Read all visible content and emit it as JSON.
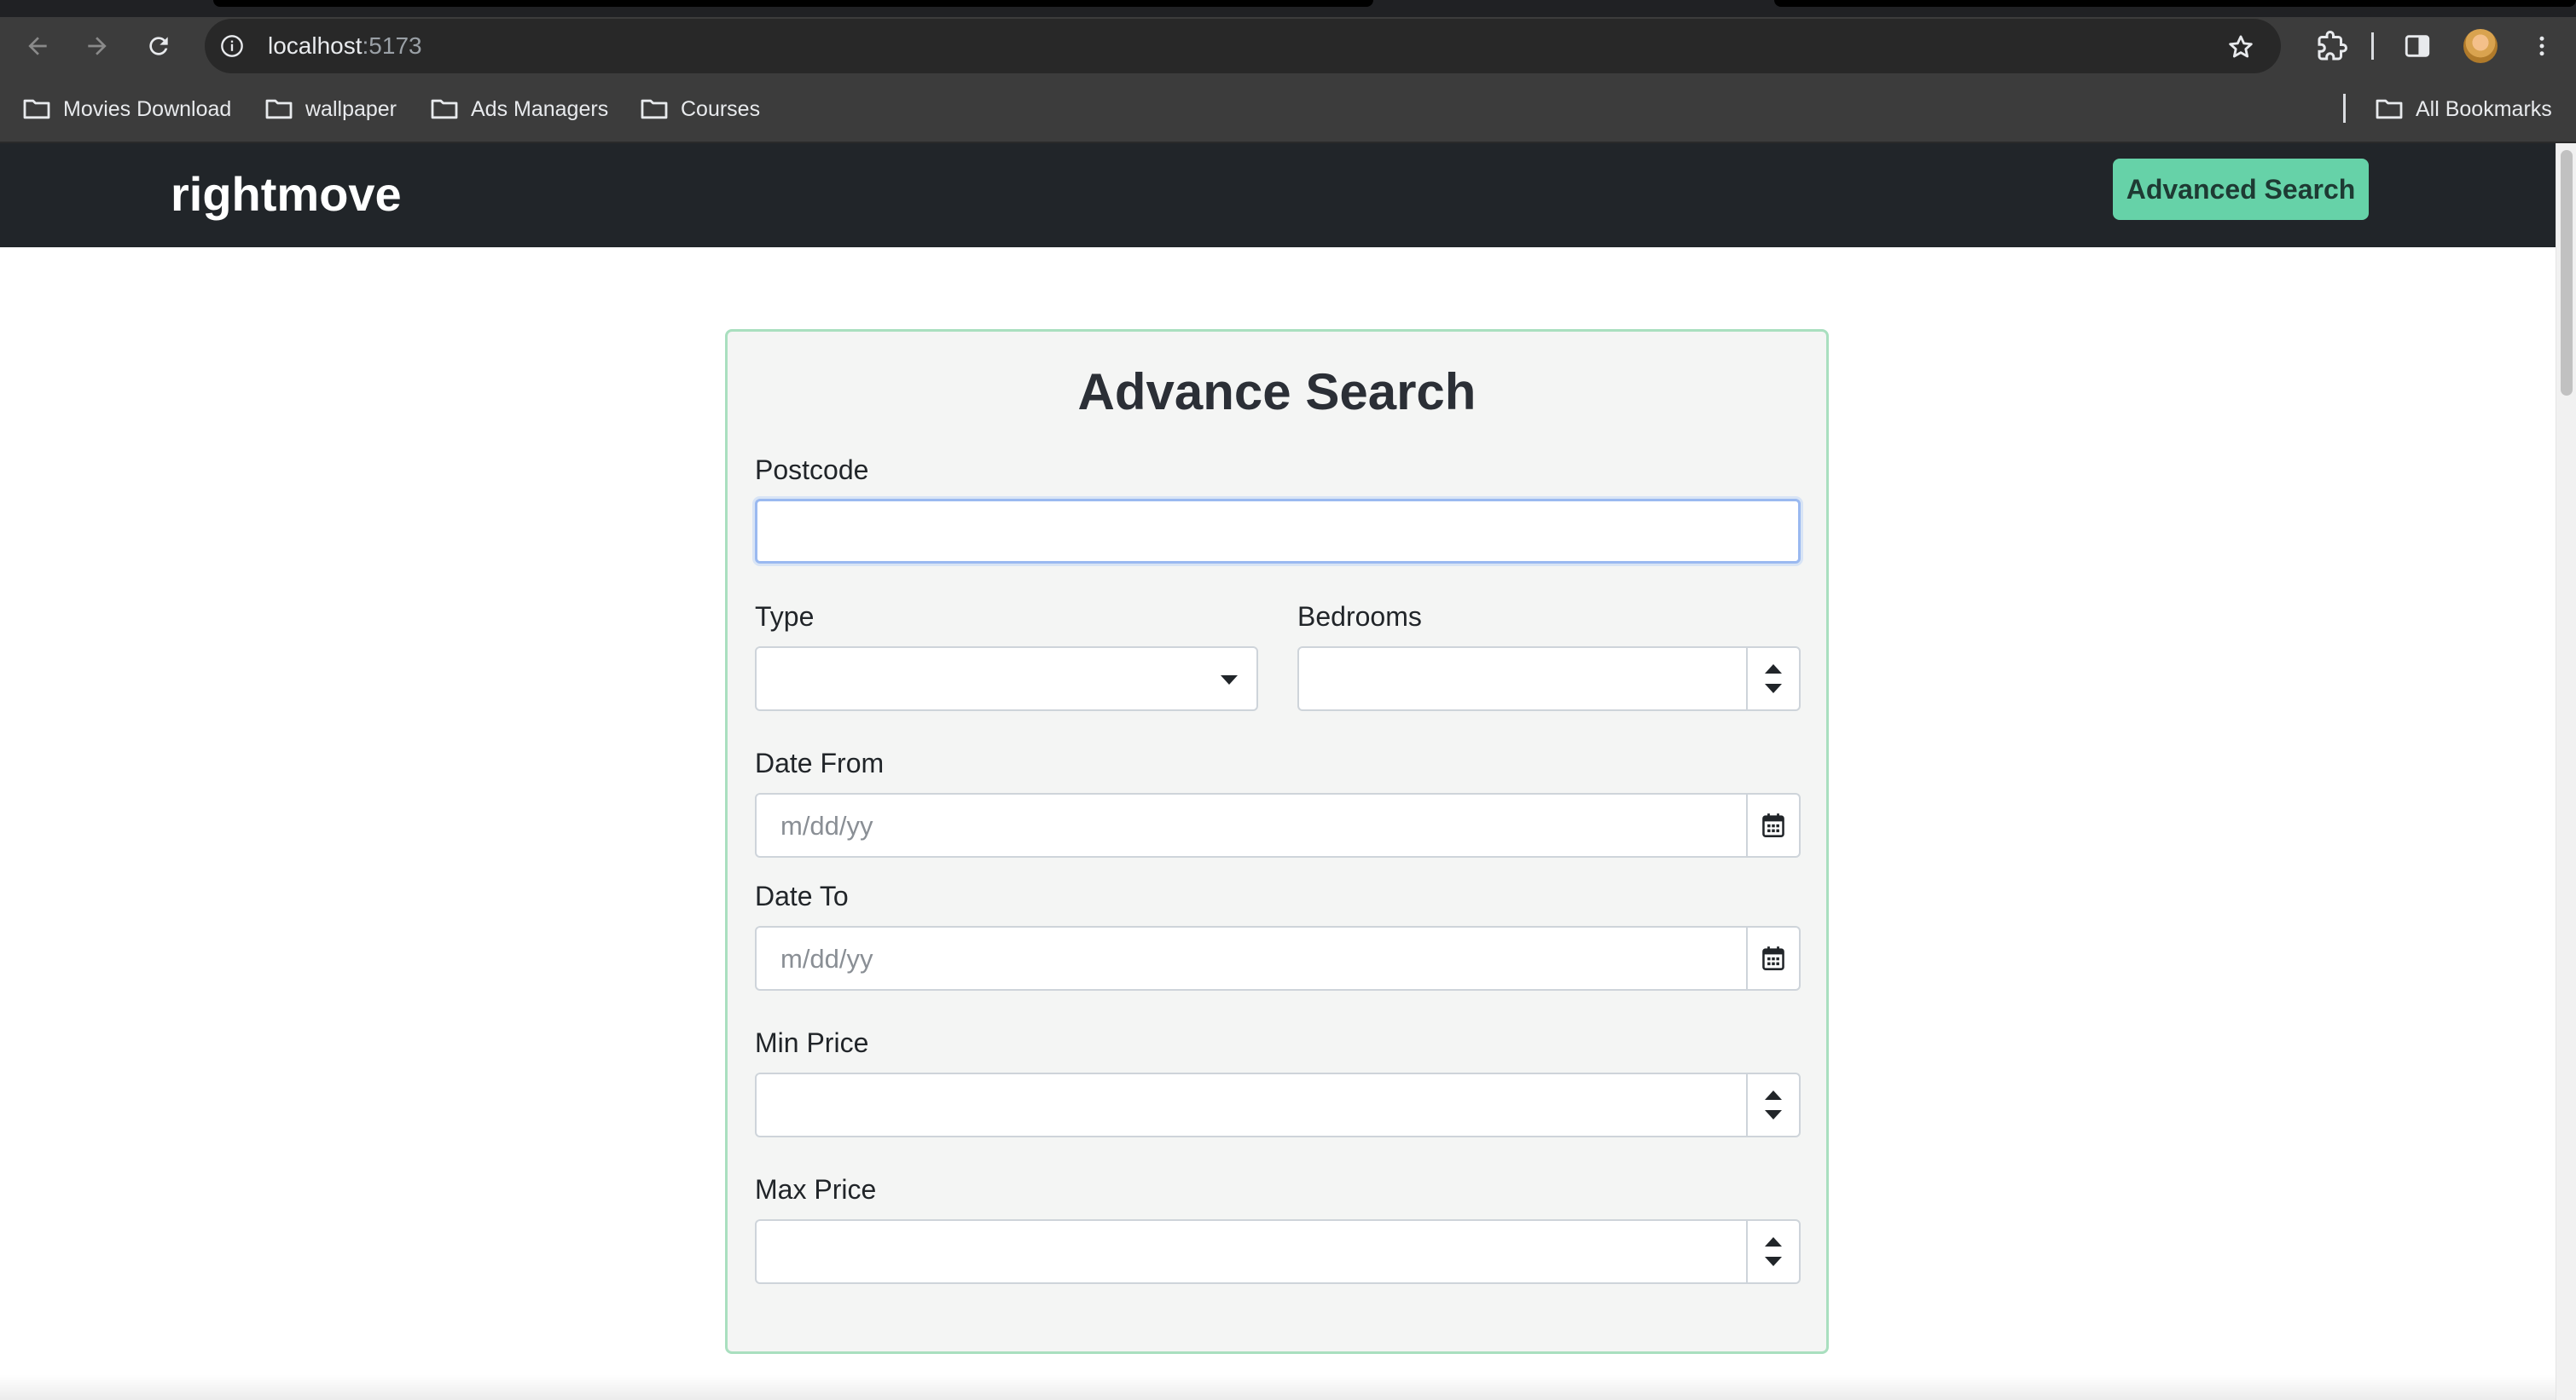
{
  "browser": {
    "url_host": "localhost",
    "url_port": ":5173",
    "bookmarks": [
      {
        "label": "Movies Download"
      },
      {
        "label": "wallpaper"
      },
      {
        "label": "Ads Managers"
      },
      {
        "label": "Courses"
      }
    ],
    "all_bookmarks_label": "All Bookmarks"
  },
  "navbar": {
    "brand": "rightmove",
    "advanced_search_label": "Advanced Search",
    "button_color": "#66d2a8",
    "background_color": "#212529"
  },
  "form": {
    "title": "Advance Search",
    "postcode": {
      "label": "Postcode",
      "value": ""
    },
    "type": {
      "label": "Type",
      "selected": ""
    },
    "bedrooms": {
      "label": "Bedrooms",
      "value": ""
    },
    "date_from": {
      "label": "Date From",
      "placeholder": "m/dd/yy"
    },
    "date_to": {
      "label": "Date To",
      "placeholder": "m/dd/yy"
    },
    "min_price": {
      "label": "Min Price",
      "value": ""
    },
    "max_price": {
      "label": "Max Price",
      "value": ""
    }
  },
  "icons": {
    "back": "arrow-left-icon",
    "forward": "arrow-right-icon",
    "reload": "reload-icon",
    "site_info": "info-icon",
    "bookmark_star": "star-icon",
    "extensions": "puzzle-icon",
    "side_panel": "side-panel-icon",
    "menu": "kebab-menu-icon",
    "folder": "folder-icon",
    "calendar": "calendar-icon"
  }
}
